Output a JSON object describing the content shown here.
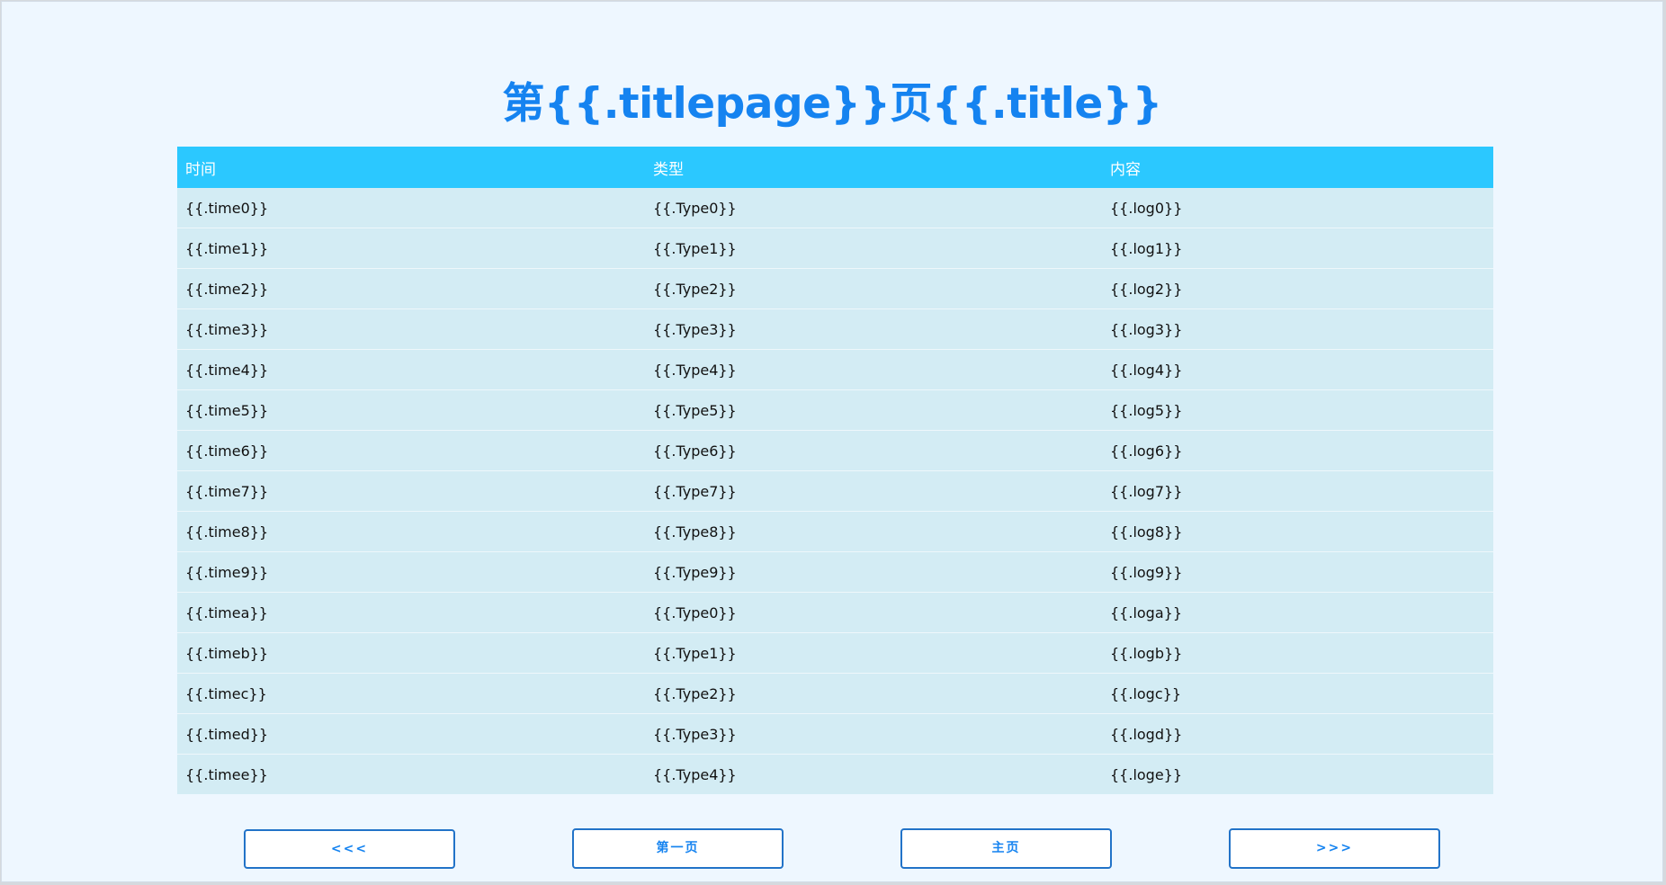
{
  "page": {
    "title": "第{{.titlepage}}页{{.title}}"
  },
  "table": {
    "headers": [
      "时间",
      "类型",
      "内容"
    ],
    "rows": [
      [
        "{{.time0}}",
        "{{.Type0}}",
        "{{.log0}}"
      ],
      [
        "{{.time1}}",
        "{{.Type1}}",
        "{{.log1}}"
      ],
      [
        "{{.time2}}",
        "{{.Type2}}",
        "{{.log2}}"
      ],
      [
        "{{.time3}}",
        "{{.Type3}}",
        "{{.log3}}"
      ],
      [
        "{{.time4}}",
        "{{.Type4}}",
        "{{.log4}}"
      ],
      [
        "{{.time5}}",
        "{{.Type5}}",
        "{{.log5}}"
      ],
      [
        "{{.time6}}",
        "{{.Type6}}",
        "{{.log6}}"
      ],
      [
        "{{.time7}}",
        "{{.Type7}}",
        "{{.log7}}"
      ],
      [
        "{{.time8}}",
        "{{.Type8}}",
        "{{.log8}}"
      ],
      [
        "{{.time9}}",
        "{{.Type9}}",
        "{{.log9}}"
      ],
      [
        "{{.timea}}",
        "{{.Type0}}",
        "{{.loga}}"
      ],
      [
        "{{.timeb}}",
        "{{.Type1}}",
        "{{.logb}}"
      ],
      [
        "{{.timec}}",
        "{{.Type2}}",
        "{{.logc}}"
      ],
      [
        "{{.timed}}",
        "{{.Type3}}",
        "{{.logd}}"
      ],
      [
        "{{.timee}}",
        "{{.Type4}}",
        "{{.loge}}"
      ]
    ]
  },
  "nav": {
    "prev_label": "<<<",
    "first_label": "第一页",
    "home_label": "主页",
    "next_label": ">>>"
  },
  "colors": {
    "title": "#1583f0",
    "header_bg": "#2bc8ff",
    "row_bg": "#d3ecf4",
    "page_bg": "#eef7ff",
    "button_border": "#2273c8"
  }
}
